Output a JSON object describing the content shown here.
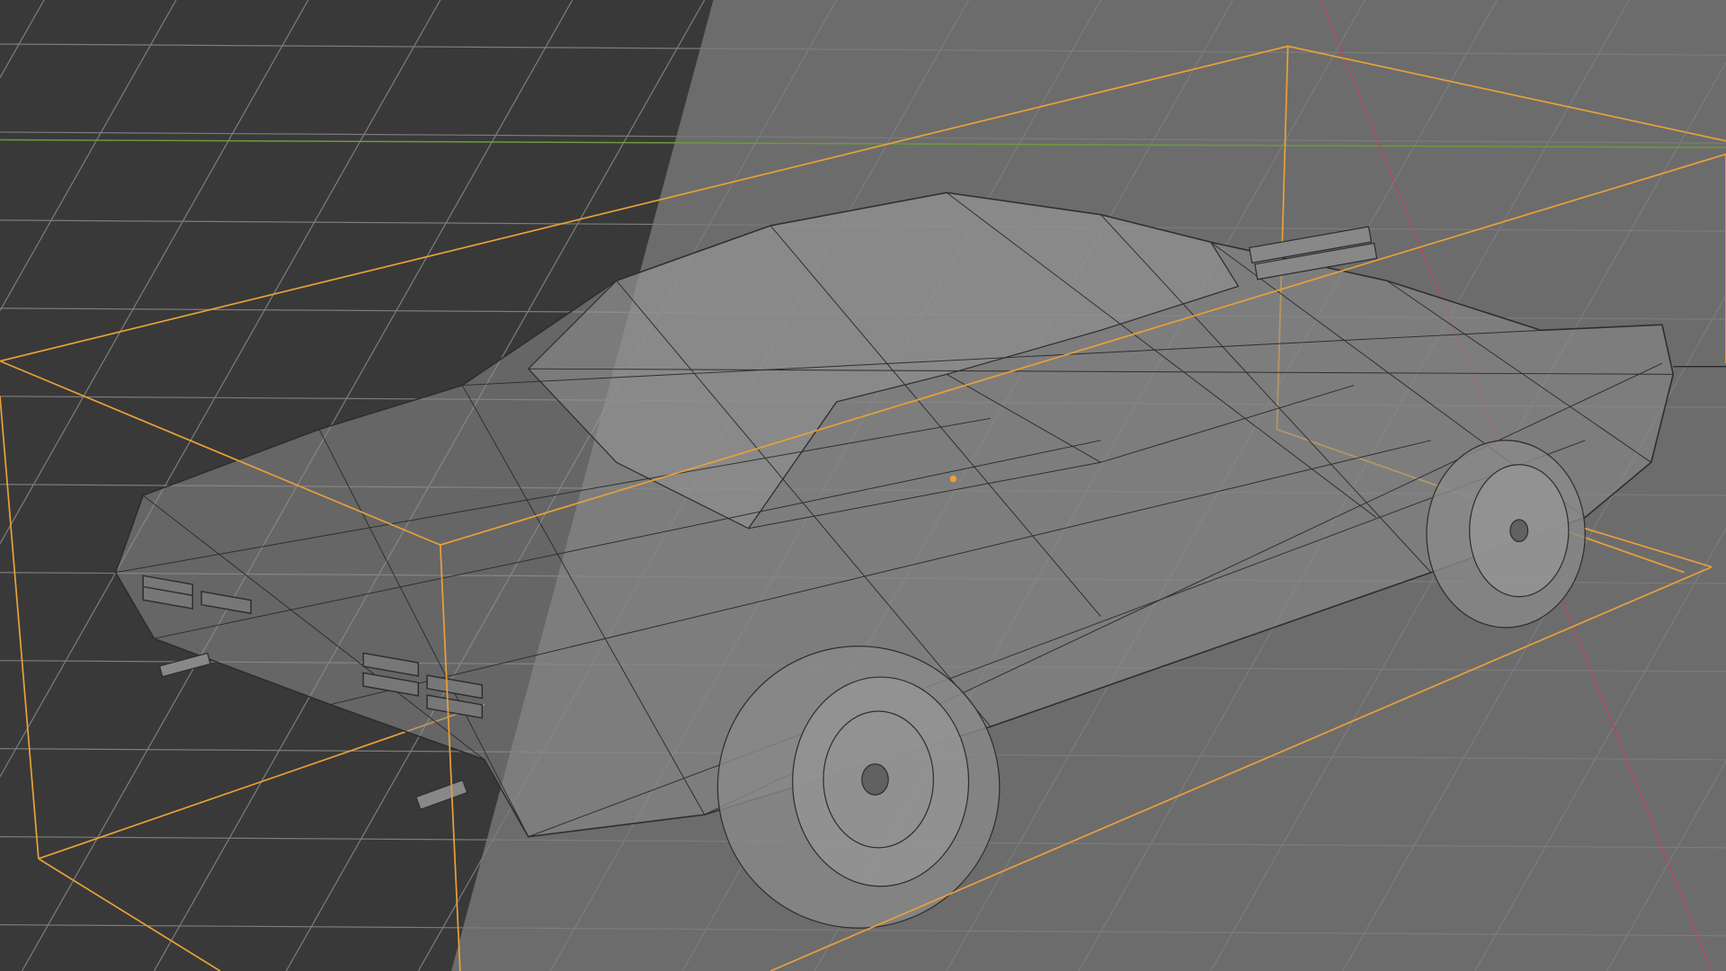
{
  "viewport": {
    "mode": "wireframe-xray",
    "colors": {
      "background_light": "#6c6c6c",
      "background_dark": "#393939",
      "grid": "#7b7b7b",
      "grid_dark": "#4a4a4a",
      "x_axis": "#b8485a",
      "y_axis": "#6e9a3a",
      "bounding_box": "#e8a03a",
      "wire": "#2e2e2e",
      "body_fill": "#8c8c8c"
    },
    "icons": [
      "car-mesh-icon",
      "origin-point-icon"
    ]
  }
}
